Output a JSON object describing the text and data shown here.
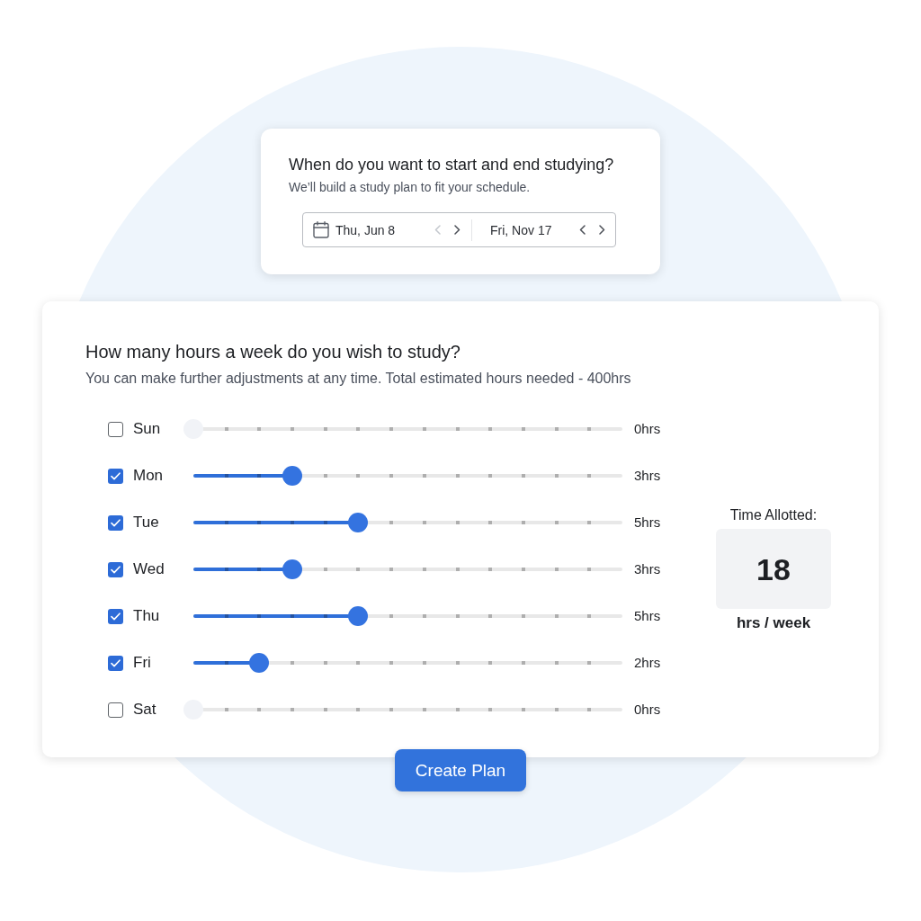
{
  "date_card": {
    "title": "When do you want to start and end studying?",
    "subtitle": "We’ll build a study plan to fit your schedule.",
    "dates": [
      {
        "value": "Thu, Jun 8",
        "prev": {
          "disabled": true
        },
        "next": {
          "disabled": false
        }
      },
      {
        "value": "Fri, Nov 17",
        "prev": {
          "disabled": false
        },
        "next": {
          "disabled": false
        }
      }
    ]
  },
  "hours_card": {
    "title": "How many hours a week do you wish to study?",
    "subtitle": "You can make further adjustments at any time. Total estimated hours needed - 400hrs",
    "days": [
      {
        "label": "Sun",
        "checked": false,
        "level": 0,
        "hours": "0hrs"
      },
      {
        "label": "Mon",
        "checked": true,
        "level": 0.2308,
        "hours": "3hrs"
      },
      {
        "label": "Tue",
        "checked": true,
        "level": 0.3846,
        "hours": "5hrs"
      },
      {
        "label": "Wed",
        "checked": true,
        "level": 0.2308,
        "hours": "3hrs"
      },
      {
        "label": "Thu",
        "checked": true,
        "level": 0.3846,
        "hours": "5hrs"
      },
      {
        "label": "Fri",
        "checked": true,
        "level": 0.1538,
        "hours": "2hrs"
      },
      {
        "label": "Sat",
        "checked": false,
        "level": 0,
        "hours": "0hrs"
      }
    ],
    "summary": {
      "label": "Time Allotted:",
      "value": "18",
      "unit": "hrs / week"
    }
  },
  "create_button": {
    "label": "Create Plan"
  }
}
